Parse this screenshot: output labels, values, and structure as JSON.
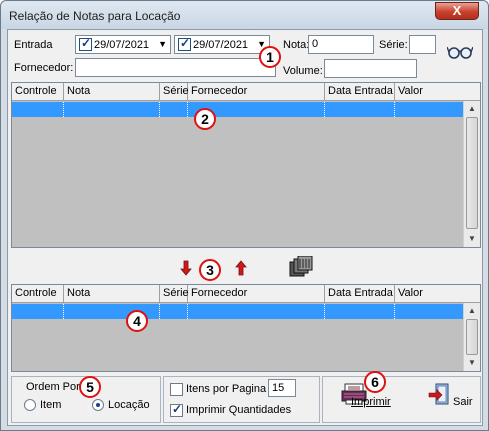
{
  "window": {
    "title": "Relação de Notas para Locação",
    "close_glyph": "X"
  },
  "filter": {
    "entrada_label": "Entrada",
    "date_from": "29/07/2021",
    "date_to": "29/07/2021",
    "nota_label": "Nota:",
    "nota_value": "0",
    "serie_label": "Série:",
    "serie_value": "",
    "fornecedor_label": "Fornecedor:",
    "fornecedor_value": "",
    "volume_label": "Volume:",
    "volume_value": "",
    "search_icon": "glasses-icon"
  },
  "grid": {
    "columns": [
      "Controle",
      "Nota",
      "Série",
      "Fornecedor",
      "Data Entrada",
      "Valor"
    ]
  },
  "transfer": {
    "down_icon": "arrow-down-icon",
    "up_icon": "arrow-up-icon",
    "all_icon": "stack-icon"
  },
  "order": {
    "label": "Ordem Por",
    "option_item": "Item",
    "option_locacao": "Locação",
    "selected": "Locação"
  },
  "options": {
    "itens_por_pagina_label": "Itens por Pagina",
    "itens_por_pagina_value": "15",
    "imprimir_quantidades_label": "Imprimir Quantidades"
  },
  "actions": {
    "print_label": "Imprimir",
    "exit_label": "Sair"
  },
  "badges": [
    "1",
    "2",
    "3",
    "4",
    "5",
    "6"
  ],
  "colors": {
    "selection": "#3399ff",
    "grid_bg": "#c0c0c0",
    "badge_ring": "#e01010",
    "close_button": "#c8412d"
  }
}
